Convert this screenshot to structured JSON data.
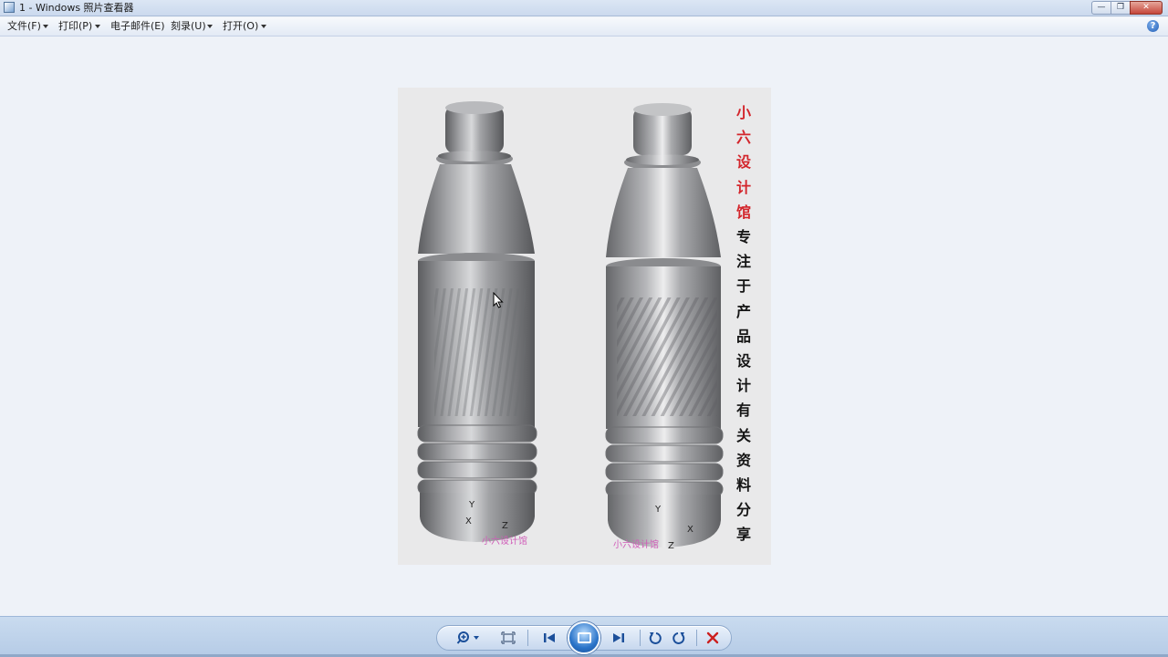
{
  "window": {
    "title": "1 - Windows 照片查看器",
    "buttons": {
      "minimize": "—",
      "restore": "❐",
      "close": "✕"
    }
  },
  "menu": {
    "items": [
      {
        "label": "文件(F)",
        "has_dropdown": true
      },
      {
        "label": "打印(P)",
        "has_dropdown": true
      },
      {
        "label": "电子邮件(E)",
        "has_dropdown": false
      },
      {
        "label": "刻录(U)",
        "has_dropdown": true
      },
      {
        "label": "打开(O)",
        "has_dropdown": true
      }
    ],
    "help": "?"
  },
  "photo": {
    "vertical_red": [
      "小",
      "六",
      "设",
      "计",
      "馆"
    ],
    "vertical_black": [
      "专",
      "注",
      "于",
      "产",
      "品",
      "设",
      "计",
      "有",
      "关",
      "资",
      "料",
      "分",
      "享"
    ],
    "watermark_left": "小六设计馆",
    "watermark_right": "小六设计馆",
    "axes_left": {
      "y": "Y",
      "x": "X",
      "z": "Z"
    },
    "axes_right": {
      "y": "Y",
      "x": "X",
      "z": "Z"
    }
  },
  "toolbar": {
    "zoom_icon": "zoom-icon",
    "fit_icon": "actual-size-icon",
    "prev_icon": "previous-icon",
    "slideshow_icon": "slideshow-icon",
    "next_icon": "next-icon",
    "rotate_ccw_icon": "rotate-counterclockwise-icon",
    "rotate_cw_icon": "rotate-clockwise-icon",
    "delete_icon": "delete-icon"
  }
}
